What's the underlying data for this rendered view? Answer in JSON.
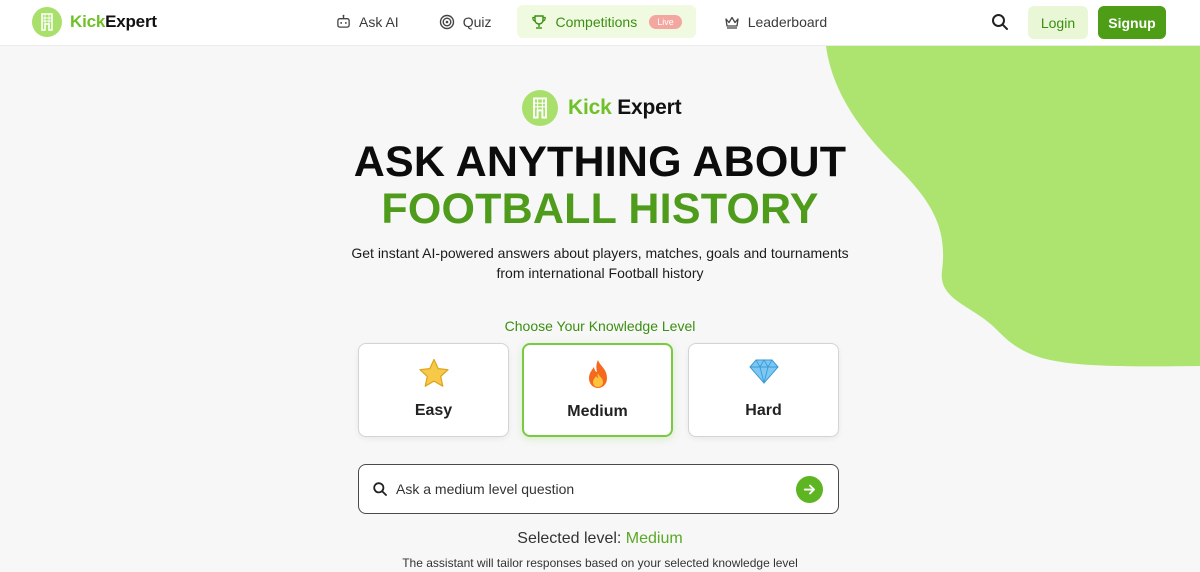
{
  "header": {
    "brand": {
      "kick": "Kick",
      "expert": "Expert",
      "logo_icon": "goalpost-icon"
    },
    "nav": [
      {
        "label": "Ask AI",
        "icon": "robot-icon"
      },
      {
        "label": "Quiz",
        "icon": "target-icon"
      },
      {
        "label": "Competitions",
        "icon": "trophy-icon",
        "badge": "Live",
        "active": true
      },
      {
        "label": "Leaderboard",
        "icon": "crown-icon"
      }
    ],
    "search_icon": "search-icon",
    "login_label": "Login",
    "signup_label": "Signup"
  },
  "hero": {
    "brand_kick": "Kick",
    "brand_expert": "Expert",
    "headline_line1": "ASK ANYTHING ABOUT",
    "headline_line2": "FOOTBALL HISTORY",
    "subtitle_line1": "Get instant AI-powered answers about players, matches, goals and tournaments",
    "subtitle_line2": "from international Football history"
  },
  "levels": {
    "label": "Choose Your Knowledge Level",
    "options": [
      {
        "label": "Easy",
        "icon": "star-icon",
        "emoji": "⭐"
      },
      {
        "label": "Medium",
        "icon": "fire-icon",
        "emoji": "🔥",
        "selected": true
      },
      {
        "label": "Hard",
        "icon": "diamond-icon",
        "emoji": "💎"
      }
    ]
  },
  "ask": {
    "placeholder": "Ask a medium level question",
    "search_icon": "search-icon",
    "send_icon": "arrow-right-icon"
  },
  "selected": {
    "prefix": "Selected level:",
    "value": "Medium"
  },
  "note": "The assistant will tailor responses based on your selected knowledge level",
  "colors": {
    "brand_green": "#6fc128",
    "accent_green": "#4f9c1c",
    "blob_green": "#ade470",
    "signup_bg": "#4d9d16",
    "live_badge": "#f4a7a0"
  }
}
